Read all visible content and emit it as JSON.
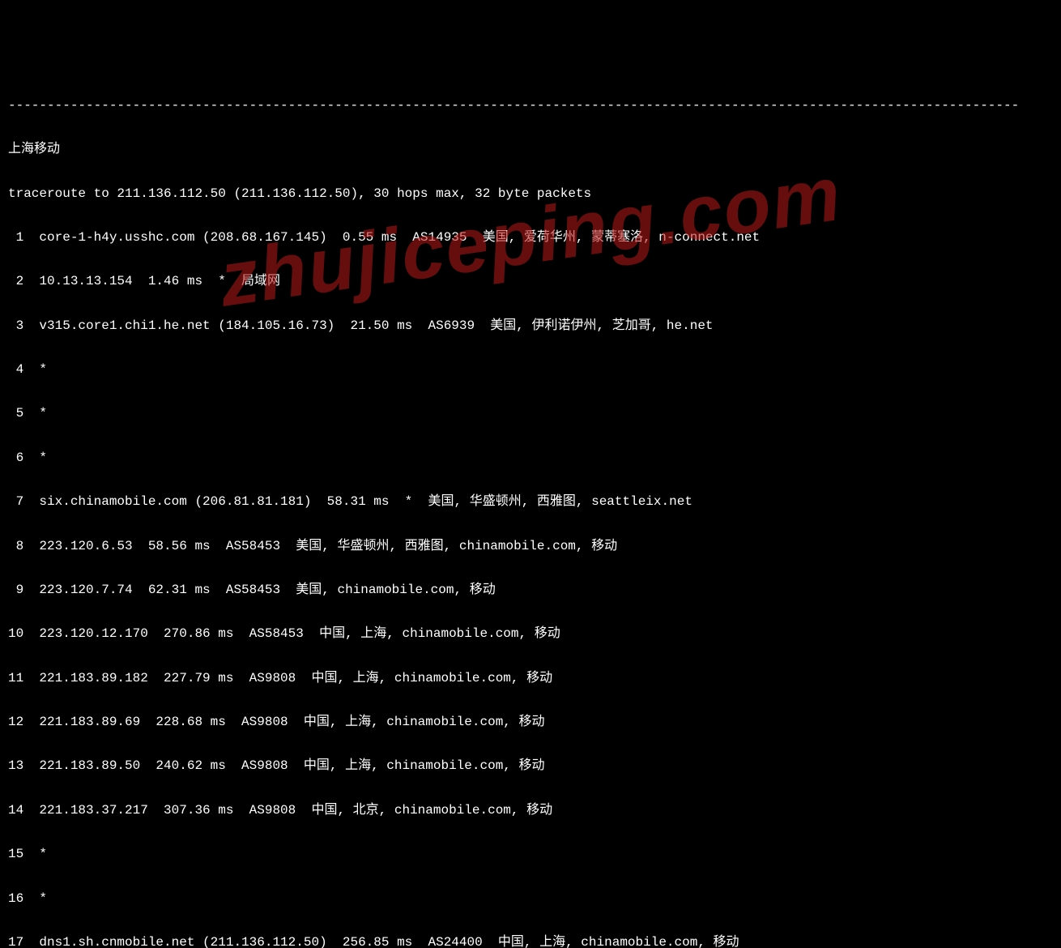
{
  "separator": "----------------------------------------------------------------------------------------------------------------------------------",
  "title": "上海移动",
  "traceroute_header": "traceroute to 211.136.112.50 (211.136.112.50), 30 hops max, 32 byte packets",
  "hops": [
    {
      "num": "1",
      "text": "core-1-h4y.usshc.com (208.68.167.145)  0.55 ms  AS14935  美国, 爱荷华州, 蒙蒂塞洛, n-connect.net"
    },
    {
      "num": "2",
      "text": "10.13.13.154  1.46 ms  *  局域网"
    },
    {
      "num": "3",
      "text": "v315.core1.chi1.he.net (184.105.16.73)  21.50 ms  AS6939  美国, 伊利诺伊州, 芝加哥, he.net"
    },
    {
      "num": "4",
      "text": "*"
    },
    {
      "num": "5",
      "text": "*"
    },
    {
      "num": "6",
      "text": "*"
    },
    {
      "num": "7",
      "text": "six.chinamobile.com (206.81.81.181)  58.31 ms  *  美国, 华盛顿州, 西雅图, seattleix.net"
    },
    {
      "num": "8",
      "text": "223.120.6.53  58.56 ms  AS58453  美国, 华盛顿州, 西雅图, chinamobile.com, 移动"
    },
    {
      "num": "9",
      "text": "223.120.7.74  62.31 ms  AS58453  美国, chinamobile.com, 移动"
    },
    {
      "num": "10",
      "text": "223.120.12.170  270.86 ms  AS58453  中国, 上海, chinamobile.com, 移动"
    },
    {
      "num": "11",
      "text": "221.183.89.182  227.79 ms  AS9808  中国, 上海, chinamobile.com, 移动"
    },
    {
      "num": "12",
      "text": "221.183.89.69  228.68 ms  AS9808  中国, 上海, chinamobile.com, 移动"
    },
    {
      "num": "13",
      "text": "221.183.89.50  240.62 ms  AS9808  中国, 上海, chinamobile.com, 移动"
    },
    {
      "num": "14",
      "text": "221.183.37.217  307.36 ms  AS9808  中国, 北京, chinamobile.com, 移动"
    },
    {
      "num": "15",
      "text": "*"
    },
    {
      "num": "16",
      "text": "*"
    },
    {
      "num": "17",
      "text": "dns1.sh.cnmobile.net (211.136.112.50)  256.85 ms  AS24400  中国, 上海, chinamobile.com, 移动"
    }
  ],
  "watermark": "zhujiceping.com"
}
